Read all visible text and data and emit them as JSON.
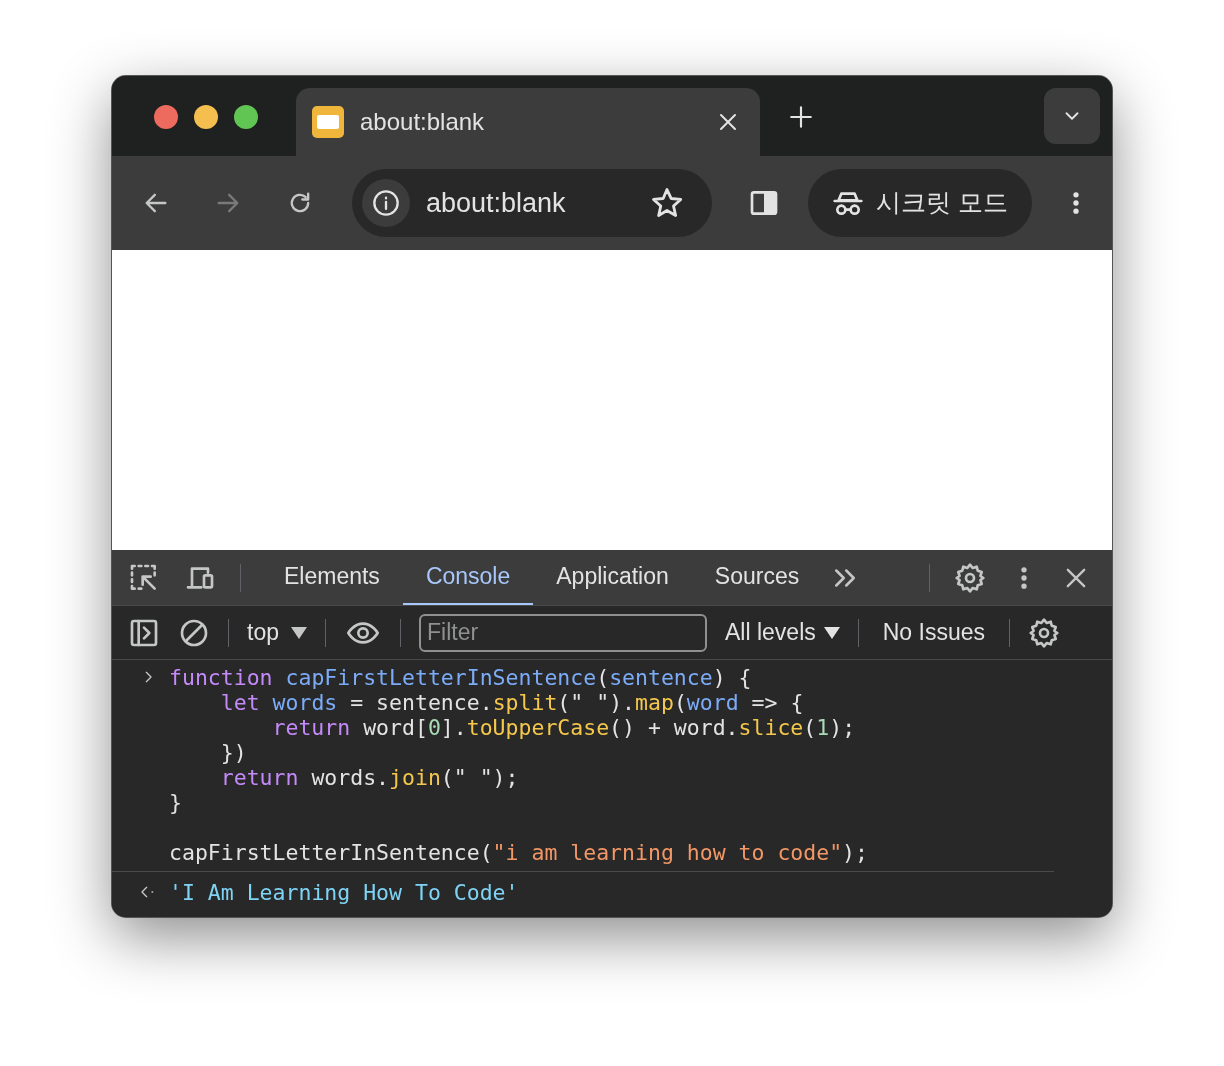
{
  "browser": {
    "tabs": [
      {
        "title": "about:blank",
        "selected": true
      }
    ],
    "toolbar": {
      "forward_disabled": true,
      "address": "about:blank",
      "incognito_label": "시크릿 모드"
    }
  },
  "devtools": {
    "tabs": [
      {
        "label": "Elements",
        "selected": false
      },
      {
        "label": "Console",
        "selected": true
      },
      {
        "label": "Application",
        "selected": false
      },
      {
        "label": "Sources",
        "selected": false
      }
    ],
    "console_toolbar": {
      "context": "top",
      "filter": {
        "placeholder": "Filter"
      },
      "levels": "All levels",
      "issues": "No Issues"
    },
    "entries": [
      {
        "kind": "input",
        "blocks": [
          [
            {
              "tokens": [
                {
                  "t": "function ",
                  "kind": "keyword"
                },
                {
                  "t": "capFirstLetterInSentence",
                  "kind": "def"
                },
                {
                  "t": "(",
                  "kind": "plain"
                },
                {
                  "t": "sentence",
                  "kind": "def"
                },
                {
                  "t": ") {",
                  "kind": "plain"
                }
              ],
              "children": [
                {
                  "tokens": [
                    {
                      "t": "let ",
                      "kind": "keyword"
                    },
                    {
                      "t": "words",
                      "kind": "def"
                    },
                    {
                      "t": " = sentence.",
                      "kind": "plain"
                    },
                    {
                      "t": "split",
                      "kind": "method"
                    },
                    {
                      "t": "(\" \").",
                      "kind": "plain"
                    },
                    {
                      "t": "map",
                      "kind": "method"
                    },
                    {
                      "t": "(",
                      "kind": "plain"
                    },
                    {
                      "t": "word",
                      "kind": "def"
                    },
                    {
                      "t": " => {",
                      "kind": "plain"
                    }
                  ],
                  "children": [
                    {
                      "tokens": [
                        {
                          "t": "return ",
                          "kind": "keyword"
                        },
                        {
                          "t": "word[",
                          "kind": "plain"
                        },
                        {
                          "t": "0",
                          "kind": "number"
                        },
                        {
                          "t": "].",
                          "kind": "plain"
                        },
                        {
                          "t": "toUpperCase",
                          "kind": "method"
                        },
                        {
                          "t": "() + word.",
                          "kind": "plain"
                        },
                        {
                          "t": "slice",
                          "kind": "method"
                        },
                        {
                          "t": "(",
                          "kind": "plain"
                        },
                        {
                          "t": "1",
                          "kind": "number"
                        },
                        {
                          "t": ");",
                          "kind": "plain"
                        }
                      ]
                    }
                  ]
                },
                {
                  "tokens": [
                    {
                      "t": "})",
                      "kind": "plain"
                    }
                  ]
                },
                {
                  "tokens": [
                    {
                      "t": "return ",
                      "kind": "keyword"
                    },
                    {
                      "t": "words.",
                      "kind": "plain"
                    },
                    {
                      "t": "join",
                      "kind": "method"
                    },
                    {
                      "t": "(\" \");",
                      "kind": "plain"
                    }
                  ]
                }
              ]
            },
            {
              "tokens": [
                {
                  "t": "}",
                  "kind": "plain"
                }
              ]
            }
          ],
          [
            {
              "tokens": [
                {
                  "t": "capFirstLetterInSentence(",
                  "kind": "plain"
                },
                {
                  "t": "\"i am learning how to code\"",
                  "kind": "string"
                },
                {
                  "t": ");",
                  "kind": "plain"
                }
              ]
            }
          ]
        ]
      },
      {
        "kind": "output",
        "blocks": [
          [
            {
              "tokens": [
                {
                  "t": "'I Am Learning How To Code'",
                  "kind": "result"
                }
              ]
            }
          ]
        ]
      }
    ]
  }
}
